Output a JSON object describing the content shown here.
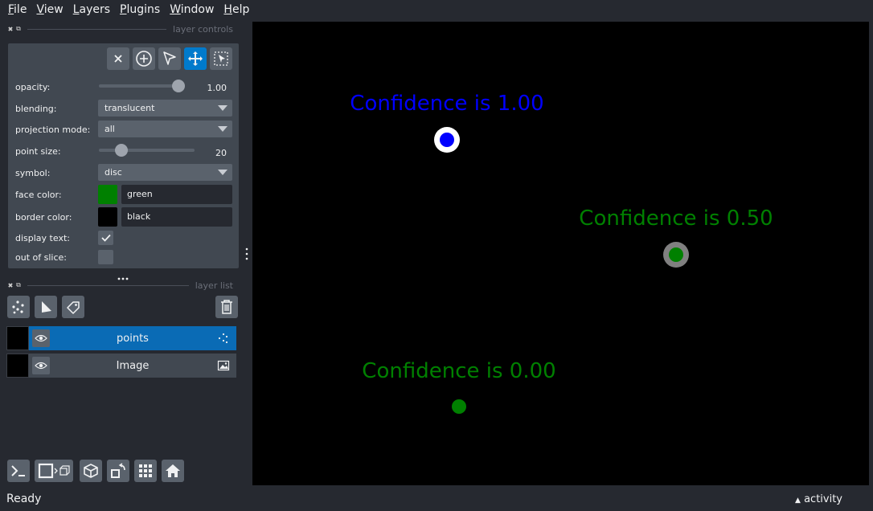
{
  "menu": [
    {
      "u": "F",
      "rest": "ile"
    },
    {
      "u": "V",
      "rest": "iew"
    },
    {
      "u": "L",
      "rest": "ayers"
    },
    {
      "u": "P",
      "rest": "lugins"
    },
    {
      "u": "W",
      "rest": "indow"
    },
    {
      "u": "H",
      "rest": "elp"
    }
  ],
  "dock": {
    "controls_title": "layer controls",
    "list_title": "layer list"
  },
  "controls": {
    "opacity_label": "opacity:",
    "opacity_value": "1.00",
    "opacity_level": 1.0,
    "blending_label": "blending:",
    "blending_value": "translucent",
    "projection_label": "projection mode:",
    "projection_value": "all",
    "point_size_label": "point size:",
    "point_size_value": "20",
    "point_size_level": 0.2,
    "symbol_label": "symbol:",
    "symbol_value": "disc",
    "face_color_label": "face color:",
    "face_color_value": "green",
    "face_color_hex": "#008000",
    "border_color_label": "border color:",
    "border_color_value": "black",
    "border_color_hex": "#000000",
    "display_text_label": "display text:",
    "display_text_checked": true,
    "out_of_slice_label": "out of slice:",
    "out_of_slice_checked": false,
    "active_tool": "move"
  },
  "layers": [
    {
      "name": "points",
      "selected": true,
      "visible": true,
      "type_icon": "points-icon"
    },
    {
      "name": "Image",
      "selected": false,
      "visible": true,
      "type_icon": "image-icon"
    }
  ],
  "canvas": {
    "points": [
      {
        "label": "Confidence is 1.00",
        "color": "#0000ff",
        "border": "#ffffff"
      },
      {
        "label": "Confidence is 0.50",
        "color": "#008000",
        "border": "#808080"
      },
      {
        "label": "Confidence is 0.00",
        "color": "#008000",
        "border": "#000000"
      }
    ]
  },
  "status": {
    "text": "Ready",
    "activity": "activity"
  }
}
